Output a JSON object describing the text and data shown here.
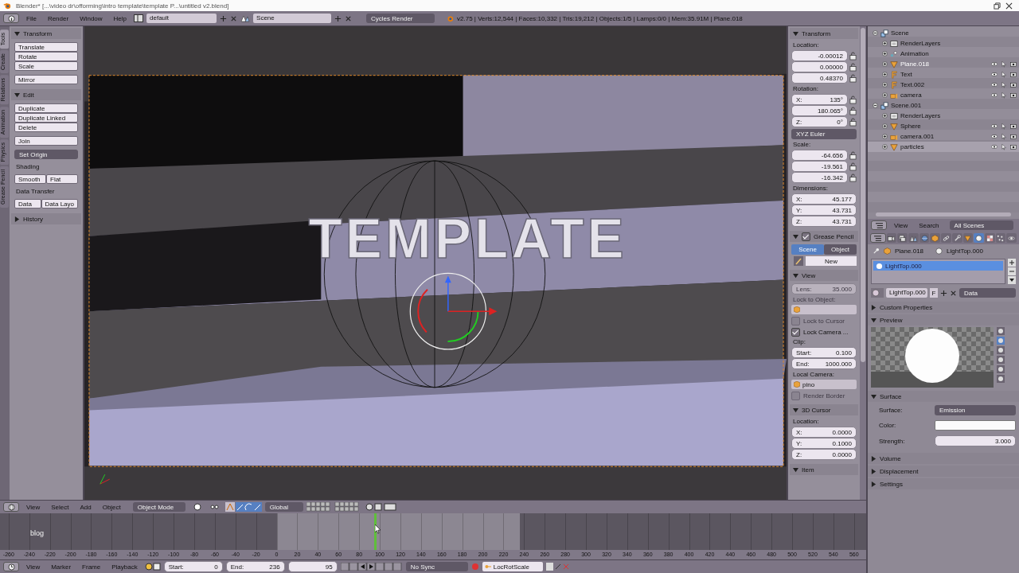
{
  "window": {
    "title": "Blender* [...\\video dr\\offorming\\intro template\\template P...\\untitled v2.blend]"
  },
  "top_bar": {
    "menus": [
      "File",
      "Render",
      "Window",
      "Help"
    ],
    "layout": "default",
    "scene": "Scene",
    "engine": "Cycles Render",
    "stats": "v2.75 | Verts:12,544 | Faces:10,332 | Tris:19,212 | Objects:1/5 | Lamps:0/0 | Mem:35.91M | Plane.018"
  },
  "tool_tabs": [
    {
      "label": "Tools",
      "selected": true
    },
    {
      "label": "Create",
      "selected": false
    },
    {
      "label": "Relations",
      "selected": false
    },
    {
      "label": "Animation",
      "selected": false
    },
    {
      "label": "Physics",
      "selected": false
    },
    {
      "label": "Grease Pencil",
      "selected": false
    }
  ],
  "tool_panels": [
    {
      "title": "Transform",
      "expanded": true,
      "items": [
        {
          "kind": "column",
          "labels": [
            "Translate",
            "Rotate",
            "Scale"
          ]
        },
        {
          "kind": "column",
          "labels": [
            "Mirror"
          ]
        }
      ]
    },
    {
      "title": "Edit",
      "expanded": true,
      "items": [
        {
          "kind": "column",
          "labels": [
            "Duplicate",
            "Duplicate Linked",
            "Delete"
          ]
        },
        {
          "kind": "column",
          "labels": [
            "Join"
          ]
        },
        {
          "kind": "dropdown",
          "label": "Set Origin"
        },
        {
          "kind": "label",
          "label": "Shading"
        },
        {
          "kind": "row",
          "labels": [
            "Smooth",
            "Flat"
          ]
        },
        {
          "kind": "label",
          "label": "Data Transfer"
        },
        {
          "kind": "row",
          "labels": [
            "Data",
            "Data Layo"
          ]
        }
      ]
    },
    {
      "title": "History",
      "expanded": false
    }
  ],
  "viewport": {
    "object_text": "TEMPLATE"
  },
  "npanel": [
    {
      "title": "Transform",
      "expanded": true,
      "items": [
        {
          "kind": "label",
          "label": "Location:",
          "disabled": false
        },
        {
          "kind": "fields",
          "locks": true,
          "disabled": false,
          "fields": [
            {
              "value": "-0.00012"
            },
            {
              "value": "0.00000"
            },
            {
              "value": "0.48370"
            }
          ]
        },
        {
          "kind": "label",
          "label": "Rotation:",
          "disabled": false
        },
        {
          "kind": "fields",
          "locks": true,
          "disabled": false,
          "fields": [
            {
              "label": "X:",
              "value": "135°"
            },
            {
              "value": "180.065°"
            },
            {
              "label": "Z:",
              "value": "0°"
            }
          ]
        },
        {
          "kind": "dropdown",
          "label": "XYZ Euler"
        },
        {
          "kind": "label",
          "label": "Scale:",
          "disabled": false
        },
        {
          "kind": "fields",
          "locks": true,
          "disabled": false,
          "fields": [
            {
              "value": "-64.656"
            },
            {
              "value": "-19.561"
            },
            {
              "value": "-16.342"
            }
          ]
        },
        {
          "kind": "label",
          "label": "Dimensions:",
          "disabled": false
        },
        {
          "kind": "fields",
          "locks": false,
          "disabled": false,
          "fields": [
            {
              "label": "X:",
              "value": "45.177"
            },
            {
              "label": "Y:",
              "value": "43.731"
            },
            {
              "label": "Z:",
              "value": "43.731"
            }
          ]
        }
      ]
    },
    {
      "title": "Grease Pencil",
      "expanded": true,
      "checked": true,
      "items": [
        {
          "kind": "toggle",
          "options": [
            {
              "label": "Scene",
              "selected": true
            },
            {
              "label": "Object",
              "selected": false
            }
          ]
        },
        {
          "kind": "new",
          "label": "New"
        }
      ]
    },
    {
      "title": "View",
      "expanded": true,
      "items": [
        {
          "kind": "fields",
          "locks": false,
          "disabled": true,
          "fields": [
            {
              "label": "Lens:",
              "value": "35.000"
            }
          ]
        },
        {
          "kind": "label",
          "label": "Lock to Object:",
          "disabled": true
        },
        {
          "kind": "picker"
        },
        {
          "kind": "checkbox",
          "label": "Lock to Cursor",
          "checked": false,
          "disabled": true
        },
        {
          "kind": "checkbox",
          "label": "Lock Camera ...",
          "checked": true,
          "disabled": false
        },
        {
          "kind": "label",
          "label": "Clip:",
          "disabled": false
        },
        {
          "kind": "fields",
          "locks": false,
          "disabled": false,
          "fields": [
            {
              "label": "Start:",
              "value": "0.100"
            },
            {
              "label": "End:",
              "value": "1000.000"
            }
          ]
        },
        {
          "kind": "label",
          "label": "Local Camera:",
          "disabled": false
        },
        {
          "kind": "picker",
          "value": "pino"
        },
        {
          "kind": "checkbox",
          "label": "Render Border",
          "checked": false,
          "disabled": true
        }
      ]
    },
    {
      "title": "3D Cursor",
      "expanded": true,
      "items": [
        {
          "kind": "label",
          "label": "Location:",
          "disabled": false
        },
        {
          "kind": "fields",
          "locks": false,
          "disabled": false,
          "fields": [
            {
              "label": "X:",
              "value": "0.0000"
            },
            {
              "label": "Y:",
              "value": "0.1000"
            },
            {
              "label": "Z:",
              "value": "0.0000"
            }
          ]
        }
      ]
    },
    {
      "title": "Item",
      "expanded": true
    }
  ],
  "outliner": {
    "tree": [
      {
        "name": "Scene",
        "kind": "scene",
        "expanded": true,
        "selected": false,
        "active": false,
        "restrict": false,
        "children": [
          {
            "name": "RenderLayers",
            "kind": "renderlayers",
            "expanded": false,
            "selected": false,
            "active": false,
            "restrict": false
          },
          {
            "name": "Animation",
            "kind": "animation",
            "expanded": false,
            "selected": false,
            "active": false,
            "restrict": false
          },
          {
            "name": "Plane.018",
            "kind": "mesh",
            "expanded": false,
            "selected": false,
            "active": true,
            "restrict": true
          },
          {
            "name": "Text",
            "kind": "text",
            "expanded": false,
            "selected": false,
            "active": false,
            "restrict": true
          },
          {
            "name": "Text.002",
            "kind": "text",
            "expanded": false,
            "selected": false,
            "active": false,
            "restrict": true
          },
          {
            "name": "camera",
            "kind": "camera",
            "expanded": false,
            "selected": false,
            "active": false,
            "restrict": true
          }
        ]
      },
      {
        "name": "Scene.001",
        "kind": "scene",
        "expanded": true,
        "selected": false,
        "active": false,
        "restrict": false,
        "children": [
          {
            "name": "RenderLayers",
            "kind": "renderlayers",
            "expanded": false,
            "selected": false,
            "active": false,
            "restrict": false
          },
          {
            "name": "Sphere",
            "kind": "mesh",
            "expanded": false,
            "selected": false,
            "active": false,
            "restrict": true
          },
          {
            "name": "camera.001",
            "kind": "camera",
            "expanded": false,
            "selected": false,
            "active": false,
            "restrict": true
          },
          {
            "name": "particles",
            "kind": "mesh",
            "expanded": false,
            "selected": true,
            "active": false,
            "restrict": true
          }
        ]
      }
    ],
    "header": {
      "view": "View",
      "search": "Search",
      "filter": "All Scenes"
    }
  },
  "properties": {
    "tabs": [
      {
        "kind": "render",
        "selected": false
      },
      {
        "kind": "layers",
        "selected": false
      },
      {
        "kind": "scene",
        "selected": false
      },
      {
        "kind": "world",
        "selected": false
      },
      {
        "kind": "object",
        "selected": false
      },
      {
        "kind": "constraints",
        "selected": false
      },
      {
        "kind": "modifiers",
        "selected": false
      },
      {
        "kind": "data",
        "selected": false
      },
      {
        "kind": "material",
        "selected": true
      },
      {
        "kind": "texture",
        "selected": false
      },
      {
        "kind": "particles",
        "selected": false
      },
      {
        "kind": "physics",
        "selected": false
      }
    ],
    "breadcrumb": [
      "Plane.018",
      "LightTop.000"
    ],
    "slots": [
      {
        "name": "LightTop.000",
        "selected": true
      }
    ],
    "datablock": {
      "name": "LightTop.000",
      "users": "F",
      "link": "Data"
    },
    "panels": [
      {
        "title": "Custom Properties",
        "expanded": false
      },
      {
        "title": "Preview",
        "expanded": true,
        "kind": "preview"
      },
      {
        "title": "Surface",
        "expanded": true,
        "kind": "surface",
        "rows": [
          {
            "kind": "dropdown",
            "label": "Surface:",
            "value": "Emission"
          },
          {
            "kind": "color",
            "label": "Color:"
          },
          {
            "kind": "number",
            "label": "Strength:",
            "value": "3.000"
          }
        ]
      },
      {
        "title": "Volume",
        "expanded": false
      },
      {
        "title": "Displacement",
        "expanded": false
      },
      {
        "title": "Settings",
        "expanded": false
      }
    ]
  },
  "view3d_header": {
    "menus": [
      "View",
      "Select",
      "Add",
      "Object"
    ],
    "mode": "Object Mode",
    "orientation": "Global"
  },
  "timeline": {
    "marker": "blog",
    "ruler": [
      "-260",
      "-240",
      "-220",
      "-200",
      "-180",
      "-160",
      "-140",
      "-120",
      "-100",
      "-80",
      "-60",
      "-40",
      "-20",
      "0",
      "20",
      "40",
      "60",
      "80",
      "100",
      "120",
      "140",
      "160",
      "180",
      "200",
      "220",
      "240",
      "260",
      "280",
      "300",
      "320",
      "340",
      "360",
      "380",
      "400",
      "420",
      "440",
      "460",
      "480",
      "500",
      "520",
      "540",
      "560"
    ]
  },
  "timeline_bar": {
    "menus": [
      "View",
      "Marker",
      "Frame",
      "Playback"
    ],
    "start": {
      "label": "Start:",
      "value": "0"
    },
    "end": {
      "label": "End:",
      "value": "236"
    },
    "frame": "95",
    "sync": "No Sync",
    "keying_set": "LocRotScale"
  }
}
